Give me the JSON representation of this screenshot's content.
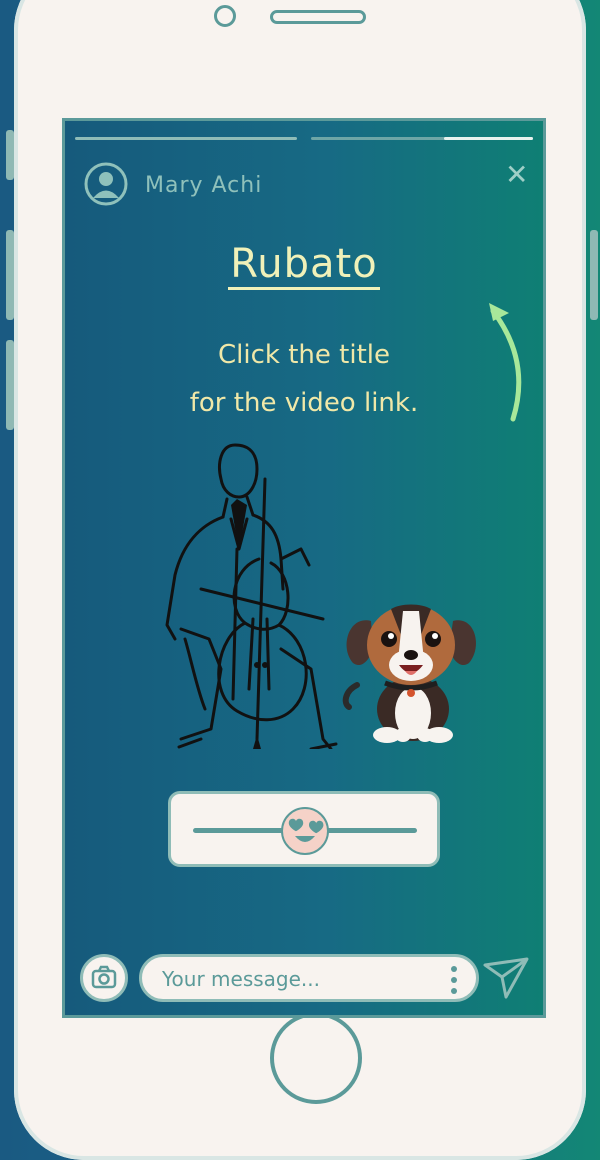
{
  "story": {
    "user_name": "Mary Achi",
    "title": "Rubato",
    "hint_lines": [
      "Click the title",
      "for the video link."
    ]
  },
  "progress": {
    "segments": 2,
    "second_segment_fraction": 0.6
  },
  "reaction_slider": {
    "emoji": "heart-eyes-face-icon",
    "value_fraction": 0.5
  },
  "composer": {
    "placeholder": "Your message..."
  },
  "icons": {
    "close": "close-icon",
    "camera": "camera-icon",
    "send": "send-icon",
    "more": "more-vertical-icon",
    "avatar": "user-avatar-icon",
    "arrow": "curved-arrow-up-icon"
  },
  "colors": {
    "screen_gradient": [
      "#165a7c",
      "#0f7f74"
    ],
    "title": "#f0f1b9",
    "accent_arrow": "#a8e89a",
    "phone_body": "#f8f3ef",
    "outline": "#5b9a99"
  }
}
